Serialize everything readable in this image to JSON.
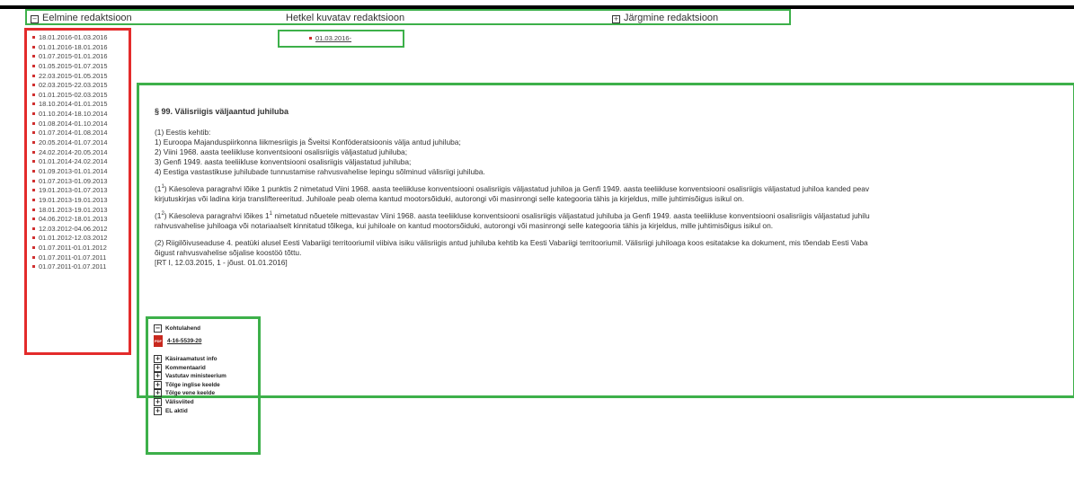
{
  "nav": {
    "previous_label": "Eelmine redaktsioon",
    "current_label": "Hetkel kuvatav redaktsioon",
    "next_label": "Järgmine redaktsioon"
  },
  "versions": [
    "18.01.2016-01.03.2016",
    "01.01.2016-18.01.2016",
    "01.07.2015-01.01.2016",
    "01.05.2015-01.07.2015",
    "22.03.2015-01.05.2015",
    "02.03.2015-22.03.2015",
    "01.01.2015-02.03.2015",
    "18.10.2014-01.01.2015",
    "01.10.2014-18.10.2014",
    "01.08.2014-01.10.2014",
    "01.07.2014-01.08.2014",
    "20.05.2014-01.07.2014",
    "24.02.2014-20.05.2014",
    "01.01.2014-24.02.2014",
    "01.09.2013-01.01.2014",
    "01.07.2013-01.09.2013",
    "19.01.2013-01.07.2013",
    "19.01.2013-19.01.2013",
    "18.01.2013-19.01.2013",
    "04.06.2012-18.01.2013",
    "12.03.2012-04.06.2012",
    "01.01.2012-12.03.2012",
    "01.07.2011-01.01.2012",
    "01.07.2011-01.07.2011",
    "01.07.2011-01.07.2011"
  ],
  "current_version": "01.03.2016-",
  "section": {
    "title": "§ 99. Välisriigis väljaantud juhiluba",
    "p1_intro": "(1) Eestis kehtib:",
    "p1_items": [
      "1) Euroopa Majanduspiirkonna liikmesriigis ja Šveitsi Konföderatsioonis välja antud juhiluba;",
      "2) Viini 1968. aasta teeliikluse konventsiooni osalisriigis väljastatud juhiluba;",
      "3) Genfi 1949. aasta teeliikluse konventsiooni osalisriigis väljastatud juhiluba;",
      "4) Eestiga vastastikuse juhilubade tunnustamise rahvusvahelise lepingu sõlminud välisriigi juhiluba."
    ],
    "p11_open": "(1",
    "p11_sup": "1",
    "p11_line1": ") Käesoleva paragrahvi lõike 1 punktis 2 nimetatud Viini 1968. aasta teeliikluse konventsiooni osalisriigis väljastatud juhiloa ja Genfi 1949. aasta teeliikluse konventsiooni osalisriigis väljastatud juhiloa kanded peav",
    "p11_line2": "kirjutuskirjas või ladina kirja transliftereeritud. Juhiloale peab olema kantud mootorsõiduki, autorongi või masinrongi selle kategooria tähis ja kirjeldus, mille juhtimisõigus isikul on.",
    "p12_open": "(1",
    "p12_sup": "2",
    "p12_mid": ") Käesoleva paragrahvi lõikes 1",
    "p12_sup2": "1",
    "p12_line1": " nimetatud nõuetele mittevastav Viini 1968. aasta teeliikluse konventsiooni osalisriigis väljastatud juhiluba ja Genfi 1949. aasta teeliikluse konventsiooni osalisriigis väljastatud juhilu",
    "p12_line2": "rahvusvahelise juhiloaga või notariaalselt kinnitatud tõlkega, kui juhiloale on kantud mootorsõiduki, autorongi või masinrongi selle kategooria tähis ja kirjeldus, mille juhtimisõigus isikul on.",
    "p2_line1": "(2) Riigilõivuseaduse 4. peatüki alusel Eesti Vabariigi territooriumil viibiva isiku välisriigis antud juhiluba kehtib ka Eesti Vabariigi territooriumil. Välisriigi juhiloaga koos esitatakse ka dokument, mis tõendab Eesti Vaba",
    "p2_line2": "õigust rahvusvahelise sõjalise koostöö tõttu.",
    "p2_ref": "[RT I, 12.03.2015, 1 - jõust. 01.01.2016]"
  },
  "sidebar": {
    "kohtulahend_label": "Kohtulahend",
    "pdf_icon_text": "PDF",
    "document_link": "4-16-5539-20",
    "items": [
      "Käsiraamatust info",
      "Kommentaarid",
      "Vastutav ministeerium",
      "Tõlge inglise keelde",
      "Tõlge vene keelde",
      "Välisviited",
      "EL aktid"
    ]
  }
}
